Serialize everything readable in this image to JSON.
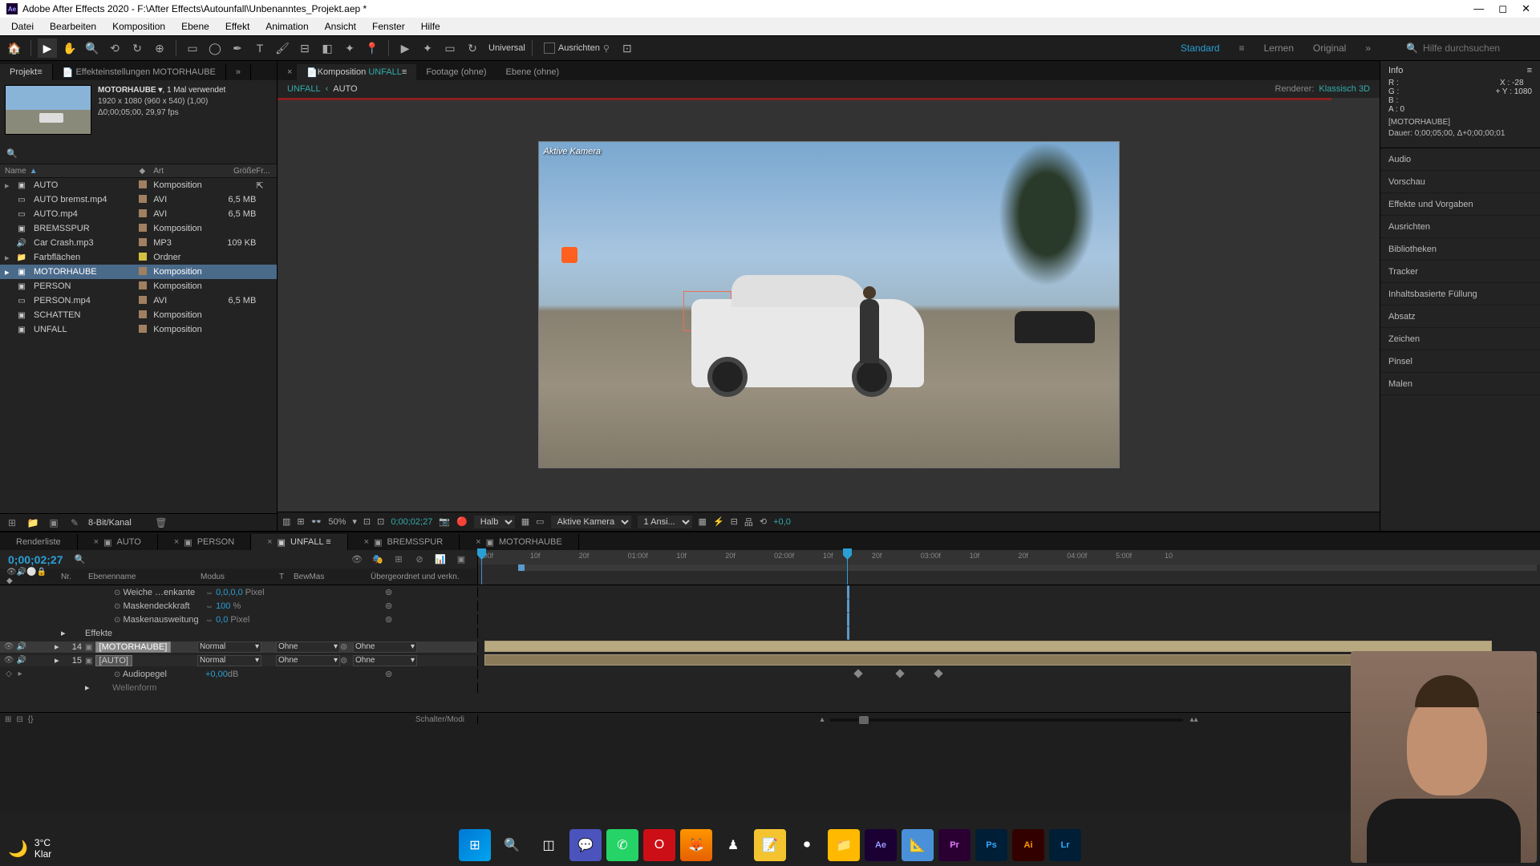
{
  "title_bar": {
    "app": "Adobe After Effects 2020",
    "path": "F:\\After Effects\\Autounfall\\Unbenanntes_Projekt.aep *"
  },
  "menu": [
    "Datei",
    "Bearbeiten",
    "Komposition",
    "Ebene",
    "Effekt",
    "Animation",
    "Ansicht",
    "Fenster",
    "Hilfe"
  ],
  "toolbar": {
    "universal": "Universal",
    "ausrichten": "Ausrichten",
    "workspaces": {
      "active": "Standard",
      "items": [
        "Standard",
        "Lernen",
        "Original"
      ]
    },
    "search_placeholder": "Hilfe durchsuchen"
  },
  "project": {
    "tab": "Projekt",
    "settings_tab": "Effekteinstellungen MOTORHAUBE",
    "selected_name": "MOTORHAUBE ▾",
    "used": ", 1 Mal verwendet",
    "dims": "1920 x 1080 (960 x 540) (1,00)",
    "dur": "Δ0;00;05;00, 29,97 fps",
    "columns": {
      "name": "Name",
      "art": "Art",
      "size": "Größe",
      "fr": "Fr..."
    },
    "assets": [
      {
        "name": "AUTO",
        "icon": "▸",
        "kind": "comp",
        "art": "Komposition",
        "size": "",
        "color": "tan",
        "link": true
      },
      {
        "name": "AUTO bremst.mp4",
        "icon": "",
        "kind": "vid",
        "art": "AVI",
        "size": "6,5 MB",
        "color": "tan"
      },
      {
        "name": "AUTO.mp4",
        "icon": "",
        "kind": "vid",
        "art": "AVI",
        "size": "6,5 MB",
        "color": "tan"
      },
      {
        "name": "BREMSSPUR",
        "icon": "",
        "kind": "comp",
        "art": "Komposition",
        "size": "",
        "color": "tan"
      },
      {
        "name": "Car Crash.mp3",
        "icon": "",
        "kind": "aud",
        "art": "MP3",
        "size": "109 KB",
        "color": "tan"
      },
      {
        "name": "Farbflächen",
        "icon": "▸",
        "kind": "folder",
        "art": "Ordner",
        "size": "",
        "color": "yellow"
      },
      {
        "name": "MOTORHAUBE",
        "icon": "▸",
        "kind": "comp",
        "art": "Komposition",
        "size": "",
        "color": "tan",
        "sel": true
      },
      {
        "name": "PERSON",
        "icon": "",
        "kind": "comp",
        "art": "Komposition",
        "size": "",
        "color": "tan"
      },
      {
        "name": "PERSON.mp4",
        "icon": "",
        "kind": "vid",
        "art": "AVI",
        "size": "6,5 MB",
        "color": "tan"
      },
      {
        "name": "SCHATTEN",
        "icon": "",
        "kind": "comp",
        "art": "Komposition",
        "size": "",
        "color": "tan"
      },
      {
        "name": "UNFALL",
        "icon": "",
        "kind": "comp",
        "art": "Komposition",
        "size": "",
        "color": "tan"
      }
    ],
    "footer_bpc": "8-Bit/Kanal"
  },
  "comp": {
    "tabs": {
      "komp": "Komposition",
      "komp_name": "UNFALL",
      "footage": "Footage (ohne)",
      "ebene": "Ebene (ohne)"
    },
    "breadcrumb": {
      "active": "UNFALL",
      "next": "AUTO"
    },
    "renderer_label": "Renderer:",
    "renderer_value": "Klassisch 3D",
    "camera_label": "Aktive Kamera",
    "footer": {
      "zoom": "50%",
      "tc": "0;00;02;27",
      "res": "Halb",
      "view": "Aktive Kamera",
      "views": "1 Ansi...",
      "exposure": "+0,0"
    }
  },
  "info": {
    "header": "Info",
    "r": "R :",
    "g": "G :",
    "b": "B :",
    "a": "A :   0",
    "x": "X : -28",
    "y": "Y : 1080",
    "sel_name": "[MOTORHAUBE]",
    "sel_dur": "Dauer: 0;00;05;00, Δ+0;00;00;01"
  },
  "right_panels": [
    "Audio",
    "Vorschau",
    "Effekte und Vorgaben",
    "Ausrichten",
    "Bibliotheken",
    "Tracker",
    "Inhaltsbasierte Füllung",
    "Absatz",
    "Zeichen",
    "Pinsel",
    "Malen"
  ],
  "timeline": {
    "tabs": [
      "Renderliste",
      "AUTO",
      "PERSON",
      "UNFALL",
      "BREMSSPUR",
      "MOTORHAUBE"
    ],
    "active_tab": "UNFALL",
    "tc": "0;00;02;27",
    "columns": {
      "nr": "Nr.",
      "name": "Ebenenname",
      "mode": "Modus",
      "t": "T",
      "bm": "BewMas",
      "parent": "Übergeordnet und verkn."
    },
    "ruler": [
      ":00f",
      "10f",
      "20f",
      "01:00f",
      "10f",
      "20f",
      "02:00f",
      "10f",
      "20f",
      "03:00f",
      "10f",
      "20f",
      "04:00f",
      "5:00f",
      "10"
    ],
    "props": [
      {
        "name": "Weiche …enkante",
        "val": "0,0,0,0",
        "unit": "Pixel",
        "sw": true
      },
      {
        "name": "Maskendeckkraft",
        "val": "100",
        "unit": "%",
        "sw": true
      },
      {
        "name": "Maskenausweitung",
        "val": "0,0",
        "unit": "Pixel",
        "sw": true
      }
    ],
    "effects_label": "Effekte",
    "layers": [
      {
        "nr": "14",
        "name": "[MOTORHAUBE]",
        "mode": "Normal",
        "track": "Ohne",
        "track2": "Ohne",
        "selected": true
      },
      {
        "nr": "15",
        "name": "[AUTO]",
        "mode": "Normal",
        "track": "Ohne",
        "track2": "Ohne"
      }
    ],
    "audio_prop": {
      "name": "Audiopegel",
      "val": "+0,00",
      "unit": "dB"
    },
    "wave_label": "Wellenform",
    "footer_switch": "Schalter/Modi"
  },
  "weather": {
    "temp": "3°C",
    "cond": "Klar"
  },
  "taskbar_apps": [
    "Ae",
    "Pr",
    "Ps",
    "Ai",
    "Lr"
  ]
}
